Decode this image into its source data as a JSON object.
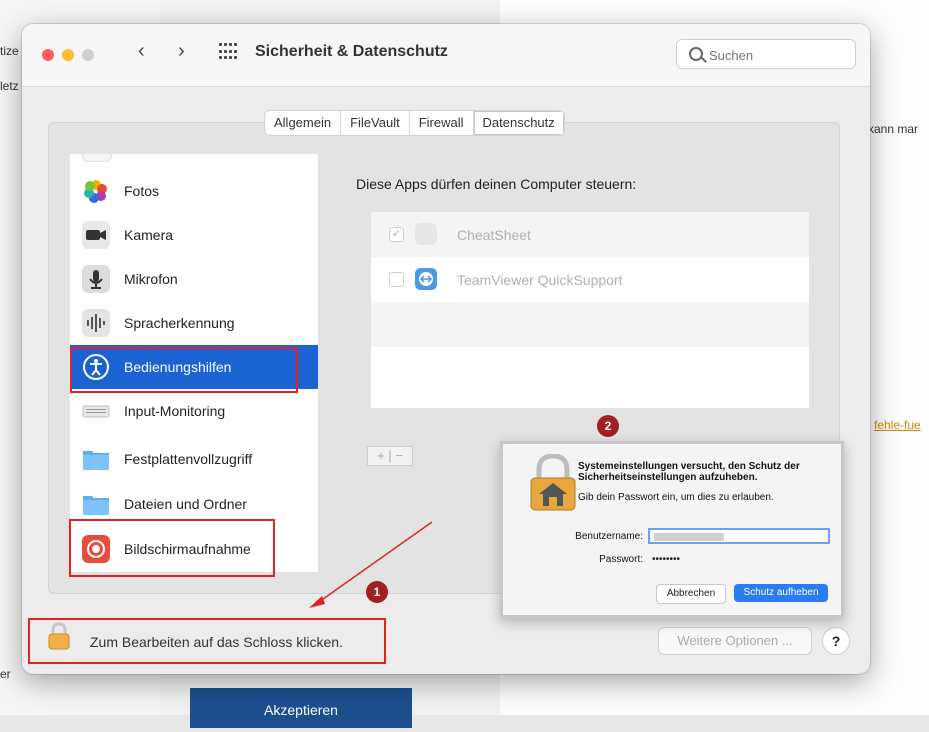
{
  "background_page": {
    "fragments": [
      "tize",
      "letz",
      "kann mar",
      "fehle-fue",
      "er"
    ],
    "button_label": "Akzeptieren"
  },
  "window": {
    "title": "Sicherheit & Datenschutz",
    "search_placeholder": "Suchen",
    "tabs": [
      {
        "label": "Allgemein",
        "active": false
      },
      {
        "label": "FileVault",
        "active": false
      },
      {
        "label": "Firewall",
        "active": false
      },
      {
        "label": "Datenschutz",
        "active": true
      }
    ]
  },
  "sidebar": {
    "items": [
      {
        "label": "Fotos",
        "icon": "photos-icon",
        "selected": false
      },
      {
        "label": "Kamera",
        "icon": "camera-icon",
        "selected": false
      },
      {
        "label": "Mikrofon",
        "icon": "microphone-icon",
        "selected": false
      },
      {
        "label": "Spracherkennung",
        "icon": "speech-recognition-icon",
        "selected": false
      },
      {
        "label": "Bedienungshilfen",
        "icon": "accessibility-icon",
        "selected": true
      },
      {
        "label": "Input-Monitoring",
        "icon": "keyboard-icon",
        "selected": false
      },
      {
        "label": "Festplattenvollzugriff",
        "icon": "folder-icon",
        "selected": false
      },
      {
        "label": "Dateien und Ordner",
        "icon": "folder-icon",
        "selected": false
      },
      {
        "label": "Bildschirmaufnahme",
        "icon": "screen-recording-icon",
        "selected": false
      }
    ]
  },
  "panel": {
    "title": "Diese Apps dürfen deinen Computer steuern:",
    "apps": [
      {
        "name": "CheatSheet",
        "checked": true,
        "icon": "cheatsheet-icon"
      },
      {
        "name": "TeamViewer QuickSupport",
        "checked": false,
        "icon": "teamviewer-icon"
      }
    ],
    "add_remove": "+ | −"
  },
  "footer": {
    "lock_text": "Zum Bearbeiten auf das Schloss klicken.",
    "more_options": "Weitere Optionen ...",
    "help": "?"
  },
  "annotations": {
    "badge_1": "1",
    "badge_2": "2"
  },
  "dialog": {
    "title": "Systemeinstellungen versucht, den Schutz der Sicherheitseinstellungen aufzuheben.",
    "subtitle": "Gib dein Passwort ein, um dies zu erlauben.",
    "username_label": "Benutzername:",
    "password_label": "Passwort:",
    "password_value": "••••••••",
    "cancel_label": "Abbrechen",
    "confirm_label": "Schutz aufheben"
  },
  "colors": {
    "selection": "#1b63d3",
    "annotation_red": "#e02424",
    "badge": "#a12020",
    "dialog_primary": "#2a7cf0"
  }
}
